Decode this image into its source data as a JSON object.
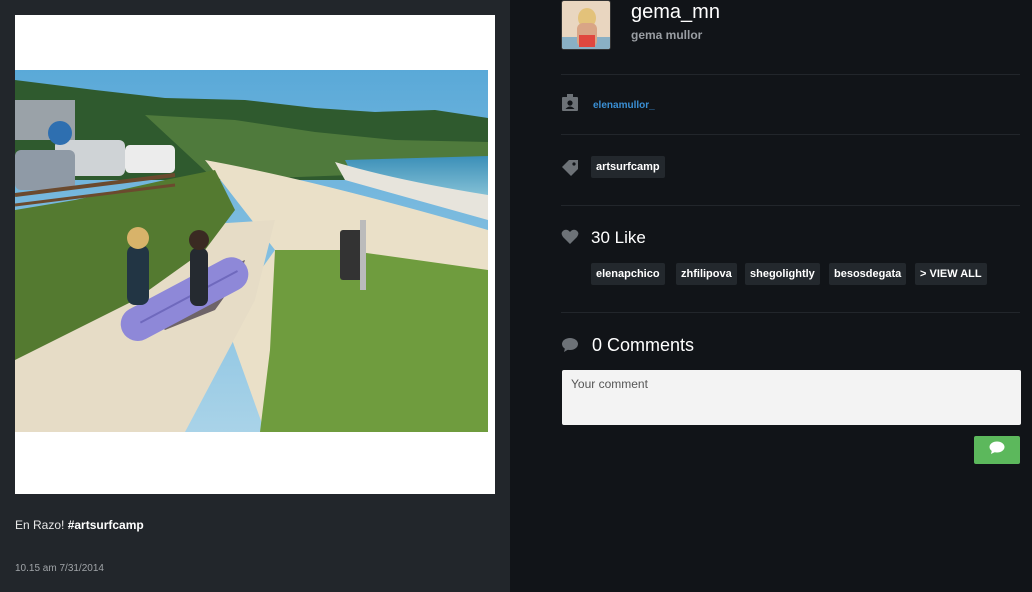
{
  "post": {
    "caption_text": "En Razo! ",
    "caption_tag": "#artsurfcamp",
    "timestamp": "10.15 am 7/31/2014"
  },
  "user": {
    "username": "gema_mn",
    "full_name": "gema mullor"
  },
  "owner": {
    "icon": "user-card-icon",
    "link": "elenamullor_"
  },
  "tags": {
    "icon": "tag-icon",
    "items": [
      "artsurfcamp"
    ]
  },
  "likes": {
    "icon": "heart-icon",
    "label": "30 Like",
    "users": [
      "elenapchico",
      "zhfilipova",
      "shegolightly",
      "besosdegata"
    ],
    "view_all": "> VIEW ALL"
  },
  "comments": {
    "icon": "comment-bubble-icon",
    "label": "0 Comments",
    "placeholder": "Your comment",
    "submit_icon": "comment-bubble-icon"
  },
  "colors": {
    "left_panel_bg": "#22262b",
    "right_panel_bg": "#111418",
    "link": "#3a8fd4",
    "send_button": "#5cb85c"
  }
}
